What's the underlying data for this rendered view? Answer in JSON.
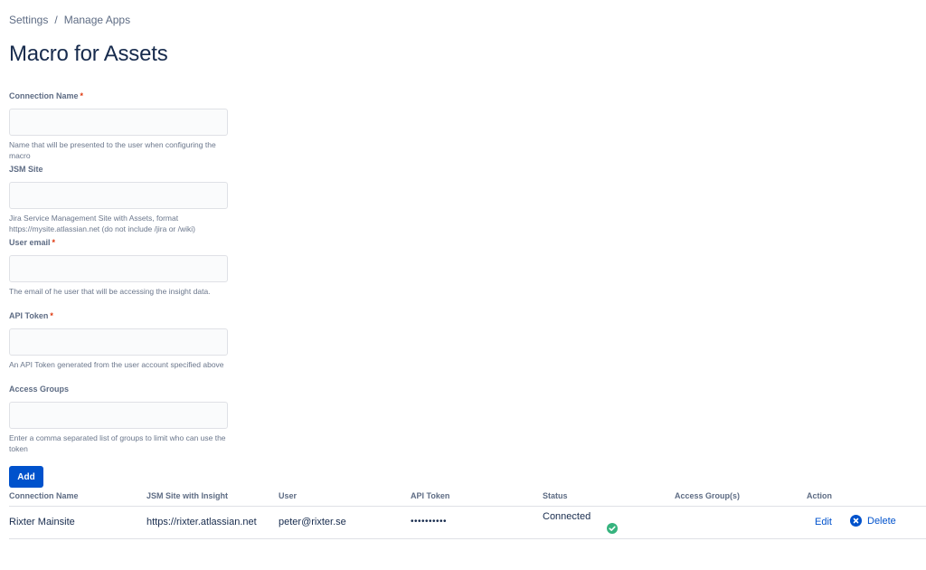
{
  "breadcrumb": {
    "items": [
      "Settings",
      "Manage Apps"
    ],
    "separator": "/"
  },
  "page": {
    "title": "Macro for Assets"
  },
  "form": {
    "connection_name": {
      "label": "Connection Name",
      "required": "*",
      "value": "",
      "help": "Name that will be presented to the user when configuring the macro"
    },
    "jsm_site": {
      "label": "JSM Site",
      "value": "",
      "help": "Jira Service Management Site with Assets, format https://mysite.atlassian.net (do not include /jira or /wiki)"
    },
    "user_email": {
      "label": "User email",
      "required": "*",
      "value": "",
      "help": "The email of he user that will be accessing the insight data."
    },
    "api_token": {
      "label": "API Token",
      "required": "*",
      "value": "",
      "help": "An API Token generated from the user account specified above"
    },
    "access_groups": {
      "label": "Access Groups",
      "value": "",
      "help": "Enter a comma separated list of groups to limit who can use the token"
    },
    "add_label": "Add"
  },
  "table": {
    "headers": [
      "Connection Name",
      "JSM Site with Insight",
      "User",
      "API Token",
      "Status",
      "Access Group(s)",
      "Action"
    ],
    "rows": [
      {
        "connection_name": "Rixter Mainsite",
        "site": "https://rixter.atlassian.net",
        "user": "peter@rixter.se",
        "token": "••••••••••",
        "status": "Connected",
        "access_groups": "",
        "edit_label": "Edit",
        "delete_label": "Delete"
      }
    ]
  },
  "icons": {
    "status": "check-circle-icon",
    "delete": "cross-circle-icon"
  },
  "colors": {
    "primary": "#0052CC",
    "success": "#36B37E",
    "required": "#DE350B",
    "text": "#172B4D",
    "subtle": "#5E6C84"
  }
}
